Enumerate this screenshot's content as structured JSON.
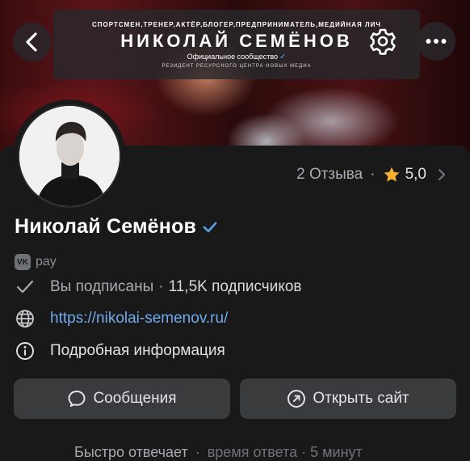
{
  "cover": {
    "tagline": "СПОРТСМЕН,ТРЕНЕР,АКТЁР,БЛОГЕР,ПРЕДПРИНИМАТЕЛЬ,МЕДИЙНАЯ ЛИЧ",
    "title": "НИКОЛАЙ СЕМЁНОВ",
    "subtitle": "Официальное сообщество",
    "footer": "РЕЗИДЕНТ РЕСУРСНОГО ЦЕНТРА НОВЫХ МЕДИА"
  },
  "header": {
    "back_icon": "chevron-left-icon",
    "settings_icon": "gear-icon",
    "more_icon": "more-horizontal-icon"
  },
  "reviews": {
    "label": "2 Отзыва",
    "separator": "·",
    "rating": "5,0",
    "star_color": "#f5b02e"
  },
  "profile": {
    "name": "Николай Семёнов",
    "verified_color": "#5aa0e6",
    "vkpay_label": "pay",
    "vkpay_logo": "VK"
  },
  "info": {
    "subscribed": "Вы подписаны",
    "separator": "·",
    "subscribers": "11,5K подписчиков",
    "website": "https://nikolai-semenov.ru/",
    "details": "Подробная информация"
  },
  "actions": {
    "messages": "Сообщения",
    "open_site": "Открыть сайт"
  },
  "bottom": {
    "response": "Быстро отвечает",
    "separator": "·",
    "response_time": "время ответа · 5 минут"
  },
  "colors": {
    "accent": "#71aaeb",
    "background": "#19191a",
    "button": "#3a3b3d"
  }
}
